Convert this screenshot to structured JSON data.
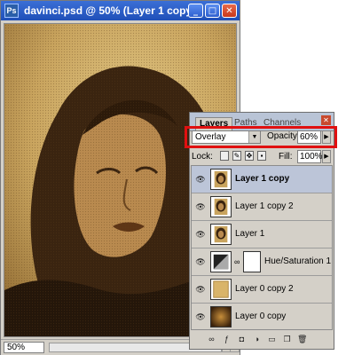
{
  "document": {
    "title": "davinci.psd @ 50% (Layer 1 copy, R...",
    "zoom": "50%",
    "app_icon": "Ps"
  },
  "window_controls": {
    "minimize_icon": "minimize-icon",
    "maximize_icon": "maximize-icon",
    "close_icon": "close-icon"
  },
  "layers_panel": {
    "tabs": [
      {
        "label": "Layers",
        "active": true
      },
      {
        "label": "Paths",
        "active": false
      },
      {
        "label": "Channels",
        "active": false
      }
    ],
    "blend_mode": "Overlay",
    "opacity_label": "Opacity:",
    "opacity_value": "60%",
    "lock_label": "Lock:",
    "fill_label": "Fill:",
    "fill_value": "100%",
    "layers": [
      {
        "name": "Layer 1 copy",
        "selected": true,
        "type": "portrait"
      },
      {
        "name": "Layer 1 copy 2",
        "selected": false,
        "type": "portrait"
      },
      {
        "name": "Layer 1",
        "selected": false,
        "type": "portrait"
      },
      {
        "name": "Hue/Saturation 1",
        "selected": false,
        "type": "adjustment"
      },
      {
        "name": "Layer 0 copy 2",
        "selected": false,
        "type": "parchment"
      },
      {
        "name": "Layer 0 copy",
        "selected": false,
        "type": "gradient"
      }
    ]
  },
  "colors": {
    "title_bar": "#2a5bd0",
    "highlight": "#e01010",
    "parchment": "#c9a45e",
    "sepia_dark": "#3a2410"
  }
}
